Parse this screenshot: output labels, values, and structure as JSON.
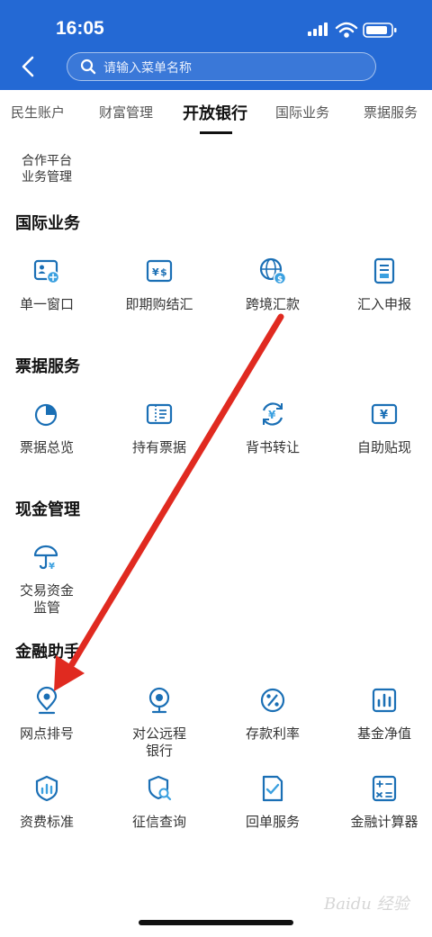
{
  "status_bar": {
    "time": "16:05"
  },
  "search": {
    "placeholder": "请输入菜单名称"
  },
  "tabs": [
    {
      "label": "民生账户",
      "active": false
    },
    {
      "label": "财富管理",
      "active": false
    },
    {
      "label": "开放银行",
      "active": true
    },
    {
      "label": "国际业务",
      "active": false
    },
    {
      "label": "票据服务",
      "active": false
    }
  ],
  "top_item": {
    "line1": "合作平台",
    "line2": "业务管理"
  },
  "sections": [
    {
      "title": "国际业务",
      "items": [
        {
          "label": "单一窗口",
          "icon": "id-card-icon"
        },
        {
          "label": "即期购结汇",
          "icon": "currency-exchange-icon"
        },
        {
          "label": "跨境汇款",
          "icon": "globe-dollar-icon"
        },
        {
          "label": "汇入申报",
          "icon": "document-icon"
        }
      ]
    },
    {
      "title": "票据服务",
      "items": [
        {
          "label": "票据总览",
          "icon": "pie-chart-icon"
        },
        {
          "label": "持有票据",
          "icon": "bill-icon"
        },
        {
          "label": "背书转让",
          "icon": "yen-transfer-icon"
        },
        {
          "label": "自助贴现",
          "icon": "yen-card-icon"
        }
      ]
    },
    {
      "title": "现金管理",
      "items": [
        {
          "label": "交易资金监管",
          "line1": "交易资金",
          "line2": "监管",
          "icon": "umbrella-yen-icon"
        }
      ]
    },
    {
      "title": "金融助手",
      "items": [
        {
          "label": "网点排号",
          "icon": "location-pin-icon"
        },
        {
          "label": "对公远程银行",
          "line1": "对公远程",
          "line2": "银行",
          "icon": "webcam-icon"
        },
        {
          "label": "存款利率",
          "icon": "percent-icon"
        },
        {
          "label": "基金净值",
          "icon": "bar-chart-icon"
        },
        {
          "label": "资费标准",
          "icon": "shield-chart-icon"
        },
        {
          "label": "征信查询",
          "icon": "shield-search-icon"
        },
        {
          "label": "回单服务",
          "icon": "receipt-check-icon"
        },
        {
          "label": "金融计算器",
          "icon": "calculator-icon"
        }
      ]
    }
  ],
  "colors": {
    "header": "#2469d4",
    "icon": "#1a6fb5",
    "arrow": "#e02a20"
  },
  "watermark": "Baidu 经验"
}
